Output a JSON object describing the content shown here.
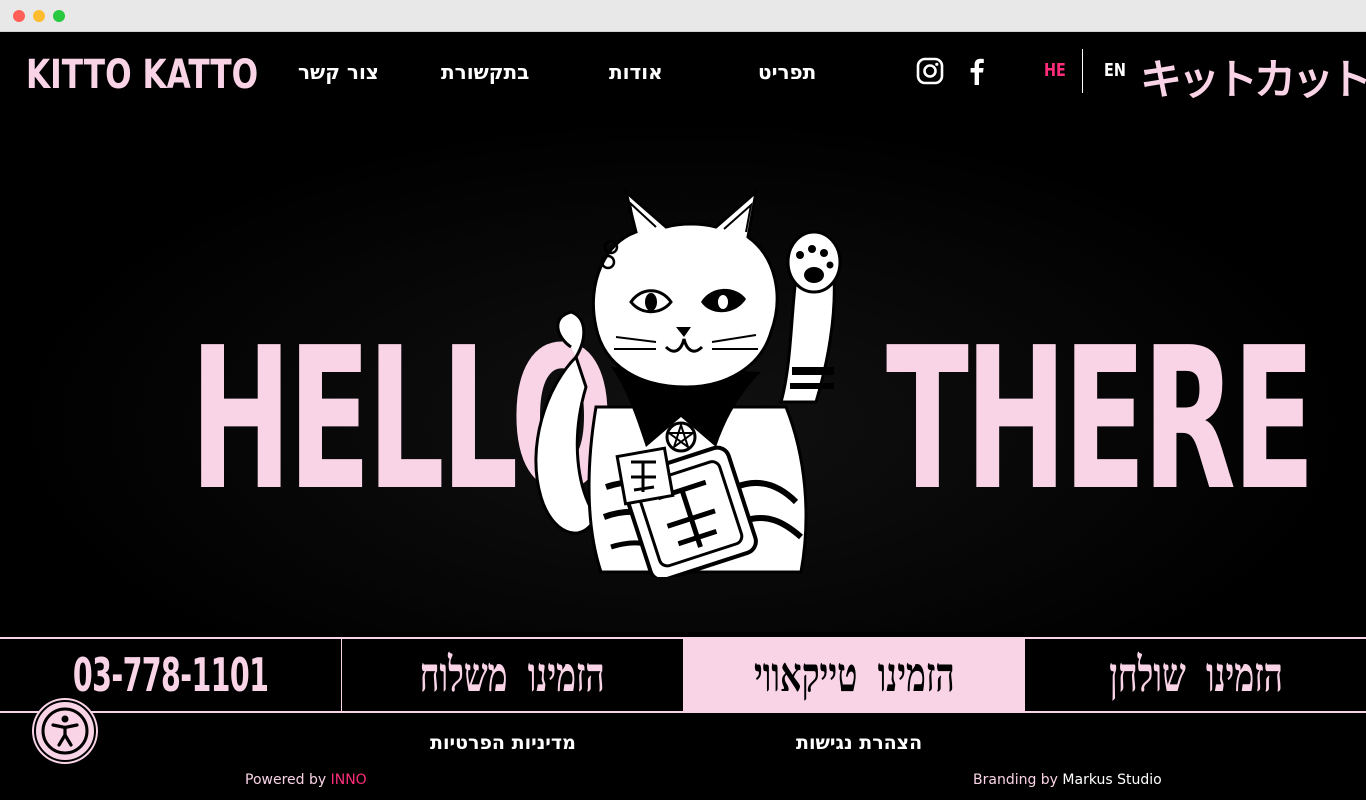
{
  "header": {
    "logo_text": "KITTO KATTO",
    "nav": [
      "צור קשר",
      "בתקשורת",
      "אודות",
      "תפריט"
    ],
    "social_icons": [
      "instagram-icon",
      "facebook-icon"
    ],
    "languages": {
      "he": "HE",
      "en": "EN",
      "active": "HE"
    },
    "jp_logo": "キットカット"
  },
  "hero": {
    "left_word": "HELLO",
    "right_word": "THERE",
    "image": "lucky-cat-illustration"
  },
  "cta_bar": {
    "phone": "03-778-1101",
    "delivery": "הזמינו משלוח",
    "takeaway": "הזמינו טייקאווי",
    "table": "הזמינו שולחן",
    "active": "takeaway"
  },
  "footer": {
    "privacy": "מדיניות הפרטיות",
    "accessibility": "הצהרת נגישות",
    "powered_prefix": "Powered by ",
    "powered_brand": "INNO",
    "branding_prefix": "Branding by ",
    "branding_studio": "Markus Studio"
  },
  "colors": {
    "background": "#000000",
    "pink": "#f9d3e6",
    "hot_pink": "#ff2d7a",
    "white": "#ffffff"
  }
}
